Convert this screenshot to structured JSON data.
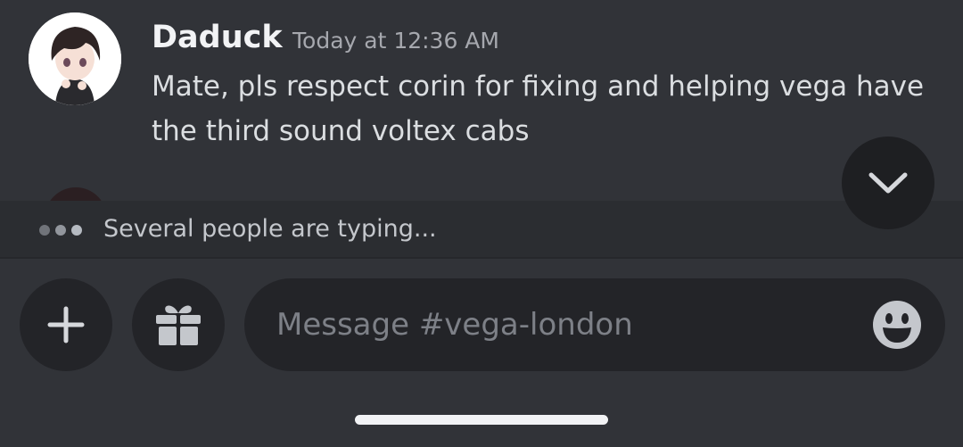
{
  "message": {
    "username": "Daduck",
    "timestamp": "Today at 12:36 AM",
    "text": "Mate, pls respect corin for fixing and helping vega have the third sound voltex cabs"
  },
  "typing": {
    "text": "Several people are typing..."
  },
  "composer": {
    "placeholder": "Message #vega-london"
  },
  "icons": {
    "add": "plus-icon",
    "gift": "gift-icon",
    "emoji": "emoji-icon",
    "jump": "chevron-down-icon"
  },
  "colors": {
    "background": "#313338",
    "input_background": "#232428",
    "typing_bar": "#2b2d31",
    "username": "#f2f3f5",
    "timestamp": "#a6a8ae"
  }
}
